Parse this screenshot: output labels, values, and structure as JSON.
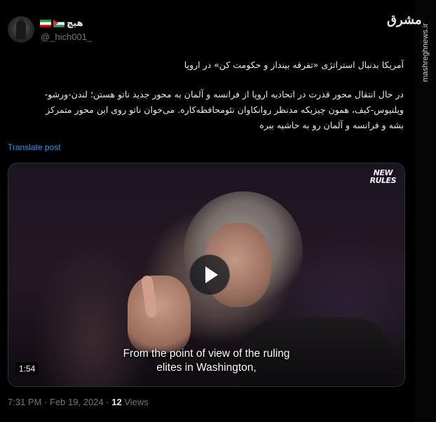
{
  "watermark": {
    "logo_text": "مشرق",
    "url": "mashreghnews.ir"
  },
  "author": {
    "display_name": "هیچ",
    "flags": [
      "flag-ir-icon",
      "flag-ps-icon"
    ],
    "handle": "@_hich001_"
  },
  "tweet": {
    "line1": "آمریکا بدنبال استراتژی «تفرقه بینداز و حکومت کن» در اروپا",
    "para2_line1": "در حال انتقال محور قدرت در اتحادیه اروپا از فرانسه و آلمان به محور جدید ناتو هستن؛ لندن-ورشو-",
    "para2_line2": "ویلنیوس-کیف، همون چیزیکه مدنظر روانکاوان نئومحافظه‌کاره. می‌خوان ناتو روی این محور متمرکز",
    "para2_line3": "بشه و فرانسه و آلمان رو به حاشیه ببره",
    "translate_label": "Translate post"
  },
  "video": {
    "channel_logo_line1": "NEW",
    "channel_logo_line2": "RULES",
    "caption_line1": "From the point of view of the ruling",
    "caption_line2": "elites in Washington,",
    "duration": "1:54"
  },
  "meta": {
    "time": "7:31 PM",
    "separator": "·",
    "date": "Feb 19, 2024",
    "views_count": "12",
    "views_label": "Views"
  }
}
